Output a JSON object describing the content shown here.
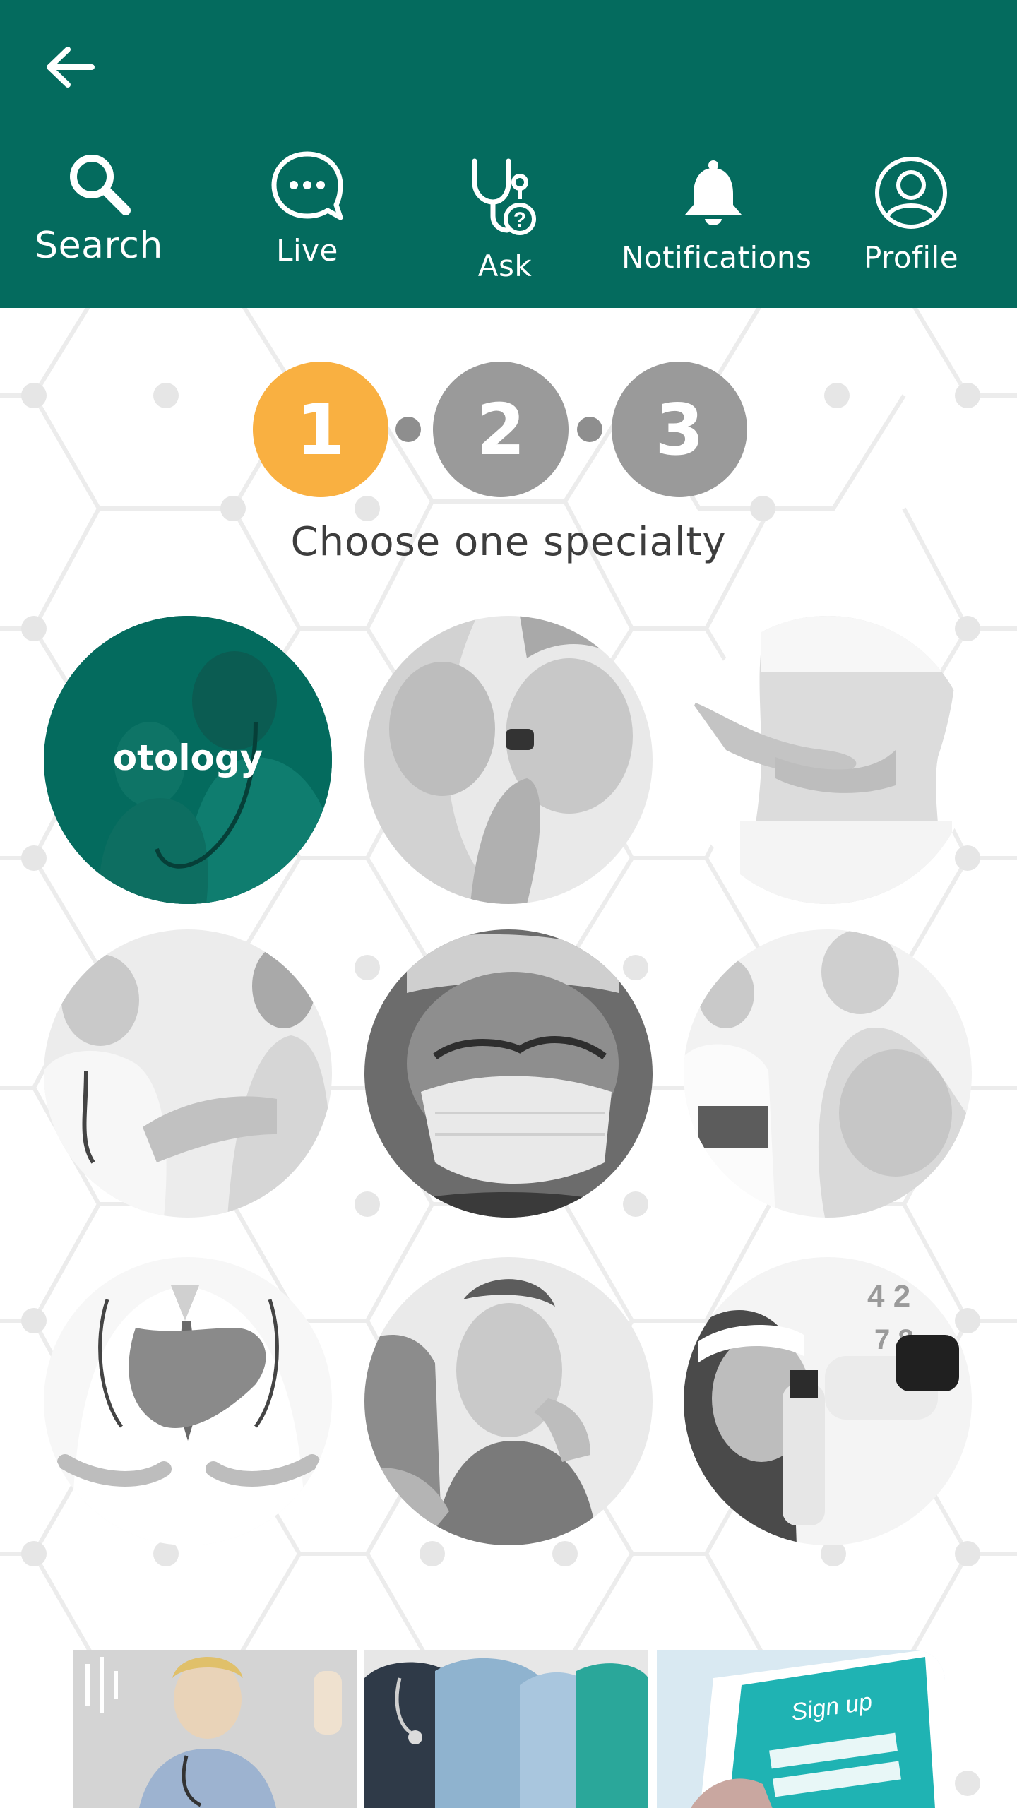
{
  "header": {
    "back_icon": "arrow-left-icon",
    "background_color": "#046b5e",
    "nav": [
      {
        "label": "Search",
        "icon": "search-icon"
      },
      {
        "label": "Live",
        "icon": "chat-bubble-icon"
      },
      {
        "label": "Ask",
        "icon": "stethoscope-question-icon"
      },
      {
        "label": "Notifications",
        "icon": "bell-icon"
      },
      {
        "label": "Profile",
        "icon": "user-circle-icon"
      }
    ]
  },
  "stepper": {
    "steps": [
      "1",
      "2",
      "3"
    ],
    "active_step": 1,
    "active_color": "#f9b041",
    "inactive_color": "#9a9a9a"
  },
  "instruction": "Choose one  specialty",
  "specialties": [
    {
      "label": "otology",
      "selected": true,
      "image": "doctor-with-child-photo"
    },
    {
      "label": "",
      "selected": false,
      "image": "ear-exam-otoscope-photo"
    },
    {
      "label": "",
      "selected": false,
      "image": "abdomen-hands-photo"
    },
    {
      "label": "",
      "selected": false,
      "image": "doctor-taking-pulse-photo"
    },
    {
      "label": "",
      "selected": false,
      "image": "surgeon-mask-photo"
    },
    {
      "label": "",
      "selected": false,
      "image": "pregnant-woman-ultrasound-photo"
    },
    {
      "label": "",
      "selected": false,
      "image": "doctor-holding-liver-photo"
    },
    {
      "label": "",
      "selected": false,
      "image": "dental-patient-photo"
    },
    {
      "label": "",
      "selected": false,
      "image": "eye-exam-photo"
    }
  ],
  "bottom_cards": [
    {
      "image": "nurse-touchscreen-photo"
    },
    {
      "image": "medical-team-photo"
    },
    {
      "image": "tablet-sign-up-photo",
      "text": "Sign up"
    }
  ]
}
